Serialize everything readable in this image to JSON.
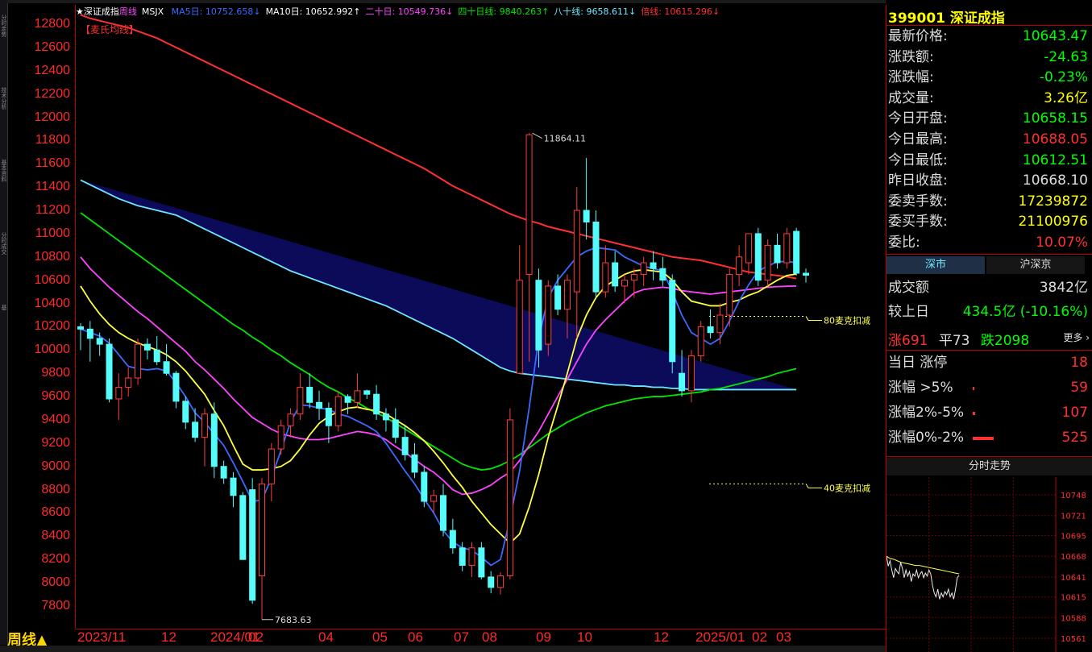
{
  "left_strip": [
    "分时走势",
    "技术分析",
    "基本资料",
    "分时成交",
    "基"
  ],
  "legend": {
    "star": "★",
    "name": "深证成指",
    "period": "周线",
    "code": "MSJX",
    "items": [
      {
        "label": "MA5日: 10752.658↓",
        "color": "#3a6bff"
      },
      {
        "label": "MA10日: 10652.992↑",
        "color": "#ffffff"
      },
      {
        "label": "二十日: 10549.736↓",
        "color": "#ff44ff"
      },
      {
        "label": "四十日线: 9840.263↑",
        "color": "#00e600"
      },
      {
        "label": "八十线: 9658.611↓",
        "color": "#6de7ff"
      },
      {
        "label": "倍线: 10615.296↓",
        "color": "#ff3030"
      }
    ],
    "tag": "【麦氏均线】"
  },
  "y_axis": {
    "ticks": [
      "12800",
      "12600",
      "12400",
      "12200",
      "12000",
      "11800",
      "11600",
      "11400",
      "11200",
      "11000",
      "10800",
      "10600",
      "10400",
      "10200",
      "10000",
      "9800",
      "9600",
      "9400",
      "9200",
      "9000",
      "8800",
      "8600",
      "8400",
      "8200",
      "8000",
      "7800"
    ]
  },
  "x_axis": {
    "labels": [
      "2023/11",
      "12",
      "2024/01",
      "02",
      "04",
      "05",
      "06",
      "07",
      "08",
      "09",
      "10",
      "12",
      "2025/01",
      "02",
      "03"
    ],
    "period_label": "周线▲"
  },
  "annotations": {
    "high": "11864.11",
    "low": "7683.63",
    "line80": "80麦克扣减",
    "line40": "40麦克扣减"
  },
  "colors": {
    "up": "#ff3c3c",
    "down": "#54fcfc",
    "axis": "#ff2a2a"
  },
  "chart_data": {
    "type": "candlestick",
    "title": "深证成指 周线",
    "ylim": [
      7650,
      12950
    ],
    "categories": [
      "2023/11",
      "",
      "",
      "",
      "12",
      "",
      "",
      "",
      "2024/01",
      "",
      "",
      "",
      "02",
      "",
      "",
      "04",
      "",
      "",
      "",
      "05",
      "",
      "",
      "06",
      "",
      "",
      "",
      "07",
      "",
      "",
      "",
      "08",
      "",
      "",
      "",
      "09",
      "",
      "",
      "",
      "10",
      "",
      "",
      "",
      "",
      "12",
      "",
      "",
      "",
      "2025/01",
      "",
      "",
      "02",
      "",
      "",
      "",
      "03",
      "",
      "",
      ""
    ],
    "ohlc": [
      [
        10200,
        10230,
        10000,
        10180
      ],
      [
        10180,
        10250,
        9900,
        10100
      ],
      [
        10100,
        10150,
        9950,
        10050
      ],
      [
        10050,
        10100,
        9550,
        9580
      ],
      [
        9580,
        9800,
        9400,
        9680
      ],
      [
        9680,
        9850,
        9600,
        9760
      ],
      [
        9760,
        10100,
        9700,
        10050
      ],
      [
        10050,
        10100,
        9920,
        10000
      ],
      [
        10000,
        10120,
        9870,
        9900
      ],
      [
        9900,
        10050,
        9780,
        9800
      ],
      [
        9800,
        9820,
        9500,
        9560
      ],
      [
        9560,
        9600,
        9320,
        9380
      ],
      [
        9380,
        9500,
        9210,
        9250
      ],
      [
        9250,
        9500,
        9000,
        9450
      ],
      [
        9450,
        9550,
        8900,
        9000
      ],
      [
        9000,
        9050,
        8850,
        8900
      ],
      [
        8900,
        8950,
        8650,
        8750
      ],
      [
        8750,
        8780,
        8200,
        8200
      ],
      [
        8800,
        8900,
        7820,
        7850
      ],
      [
        8060,
        8900,
        7684,
        8850
      ],
      [
        8850,
        9200,
        8700,
        9150
      ],
      [
        9150,
        9400,
        9100,
        9350
      ],
      [
        9350,
        9500,
        9250,
        9450
      ],
      [
        9450,
        9800,
        9400,
        9680
      ],
      [
        9680,
        9800,
        9500,
        9550
      ],
      [
        9550,
        9650,
        9400,
        9500
      ],
      [
        9500,
        9550,
        9200,
        9350
      ],
      [
        9350,
        9650,
        9300,
        9600
      ],
      [
        9600,
        9620,
        9450,
        9550
      ],
      [
        9550,
        9800,
        9500,
        9650
      ],
      [
        9650,
        9660,
        9580,
        9620
      ],
      [
        9620,
        9700,
        9400,
        9450
      ],
      [
        9450,
        9500,
        9300,
        9400
      ],
      [
        9400,
        9500,
        9200,
        9250
      ],
      [
        9250,
        9350,
        9050,
        9100
      ],
      [
        9100,
        9200,
        8900,
        8950
      ],
      [
        8950,
        9000,
        8650,
        8700
      ],
      [
        8700,
        8800,
        8600,
        8750
      ],
      [
        8750,
        8850,
        8400,
        8450
      ],
      [
        8450,
        8550,
        8250,
        8300
      ],
      [
        8300,
        8350,
        8100,
        8150
      ],
      [
        8150,
        8350,
        8050,
        8300
      ],
      [
        8300,
        8350,
        8030,
        8050
      ],
      [
        8050,
        8100,
        7910,
        7960
      ],
      [
        7960,
        8090,
        7900,
        8060
      ],
      [
        8060,
        9500,
        8030,
        9400
      ],
      [
        9800,
        10900,
        9800,
        10600
      ],
      [
        10650,
        11864,
        9900,
        11850
      ],
      [
        10600,
        10700,
        9850,
        10000
      ],
      [
        10050,
        10600,
        9950,
        10550
      ],
      [
        10550,
        10650,
        10300,
        10350
      ],
      [
        10350,
        10650,
        10100,
        10600
      ],
      [
        10500,
        11400,
        10100,
        11200
      ],
      [
        11200,
        11650,
        10950,
        11100
      ],
      [
        11100,
        11200,
        10450,
        10500
      ],
      [
        10500,
        10900,
        10450,
        10750
      ],
      [
        10750,
        10850,
        10500,
        10550
      ],
      [
        10550,
        10650,
        10400,
        10600
      ],
      [
        10600,
        10700,
        10450,
        10650
      ],
      [
        10650,
        10800,
        10550,
        10750
      ],
      [
        10750,
        10850,
        10600,
        10700
      ],
      [
        10700,
        10800,
        10550,
        10600
      ],
      [
        10600,
        10650,
        9800,
        9900
      ],
      [
        9800,
        10000,
        9600,
        9650
      ],
      [
        9650,
        10000,
        9550,
        9950
      ],
      [
        9950,
        10250,
        9900,
        10200
      ],
      [
        10200,
        10350,
        10100,
        10150
      ],
      [
        10150,
        10400,
        10050,
        10300
      ],
      [
        10300,
        10700,
        10200,
        10650
      ],
      [
        10650,
        10900,
        10550,
        10800
      ],
      [
        10750,
        11000,
        10650,
        11000
      ],
      [
        11000,
        11050,
        10550,
        10600
      ],
      [
        10600,
        10950,
        10550,
        10900
      ],
      [
        10900,
        11000,
        10700,
        10750
      ],
      [
        10750,
        11050,
        10700,
        11000
      ],
      [
        11020,
        11050,
        10640,
        10660
      ],
      [
        10660,
        10700,
        10580,
        10643
      ]
    ],
    "series": [
      {
        "name": "MA5日",
        "color": "#3a6bff",
        "values": [
          10180,
          10150,
          10120,
          10060,
          9960,
          9860,
          9840,
          9830,
          9840,
          9820,
          9720,
          9600,
          9460,
          9380,
          9280,
          9180,
          9030,
          8870,
          8700,
          8710,
          8900,
          9140,
          9380,
          9530,
          9520,
          9500,
          9490,
          9450,
          9430,
          9390,
          9350,
          9300,
          9200,
          9080,
          8960,
          8850,
          8720,
          8600,
          8450,
          8350,
          8300,
          8280,
          8220,
          8150,
          8200,
          8550,
          8960,
          9500,
          10100,
          10450,
          10600,
          10700,
          10800,
          10850,
          10880,
          10870,
          10860,
          10800,
          10760,
          10720,
          10700,
          10680,
          10500,
          10300,
          10150,
          10100,
          10050,
          10100,
          10250,
          10420,
          10560,
          10680,
          10720,
          10760,
          10760,
          10752
        ]
      },
      {
        "name": "MA10日",
        "color": "#ffff40",
        "values": [
          10550,
          10420,
          10310,
          10220,
          10150,
          10100,
          10060,
          10030,
          10000,
          9960,
          9900,
          9820,
          9720,
          9620,
          9480,
          9350,
          9180,
          9020,
          8970,
          8970,
          8980,
          9000,
          9050,
          9150,
          9270,
          9370,
          9430,
          9470,
          9500,
          9510,
          9490,
          9480,
          9450,
          9400,
          9350,
          9290,
          9220,
          9130,
          9030,
          8920,
          8820,
          8700,
          8600,
          8500,
          8420,
          8340,
          8420,
          8650,
          8930,
          9250,
          9520,
          9800,
          10100,
          10300,
          10450,
          10550,
          10600,
          10650,
          10680,
          10690,
          10680,
          10670,
          10600,
          10500,
          10420,
          10400,
          10380,
          10380,
          10410,
          10430,
          10470,
          10500,
          10550,
          10600,
          10640,
          10653
        ]
      },
      {
        "name": "二十日",
        "color": "#ff44ff",
        "values": [
          10800,
          10700,
          10620,
          10540,
          10470,
          10400,
          10330,
          10270,
          10200,
          10130,
          10060,
          9990,
          9900,
          9830,
          9750,
          9670,
          9580,
          9500,
          9420,
          9370,
          9320,
          9280,
          9260,
          9240,
          9230,
          9230,
          9240,
          9260,
          9280,
          9300,
          9290,
          9270,
          9230,
          9170,
          9120,
          9060,
          9000,
          8950,
          8880,
          8800,
          8760,
          8770,
          8800,
          8840,
          8900,
          8950,
          9050,
          9180,
          9300,
          9450,
          9600,
          9750,
          9900,
          10050,
          10170,
          10260,
          10340,
          10420,
          10490,
          10520,
          10530,
          10540,
          10530,
          10510,
          10500,
          10490,
          10480,
          10490,
          10500,
          10510,
          10520,
          10530,
          10540,
          10545,
          10548,
          10550
        ]
      },
      {
        "name": "四十日线",
        "color": "#00e600",
        "values": [
          11180,
          11120,
          11060,
          11000,
          10940,
          10880,
          10820,
          10760,
          10700,
          10640,
          10580,
          10520,
          10460,
          10400,
          10340,
          10280,
          10220,
          10170,
          10110,
          10060,
          10000,
          9950,
          9890,
          9840,
          9790,
          9730,
          9680,
          9640,
          9590,
          9550,
          9500,
          9460,
          9420,
          9370,
          9320,
          9270,
          9220,
          9170,
          9120,
          9070,
          9020,
          8990,
          8970,
          8980,
          9010,
          9050,
          9100,
          9160,
          9220,
          9280,
          9330,
          9380,
          9420,
          9460,
          9490,
          9520,
          9540,
          9560,
          9580,
          9590,
          9600,
          9600,
          9610,
          9620,
          9630,
          9640,
          9660,
          9670,
          9690,
          9710,
          9730,
          9750,
          9770,
          9800,
          9820,
          9840
        ]
      },
      {
        "name": "八十线",
        "color": "#6de7ff",
        "values": [
          11460,
          11420,
          11380,
          11340,
          11300,
          11270,
          11240,
          11220,
          11200,
          11180,
          11160,
          11120,
          11080,
          11040,
          11000,
          10960,
          10920,
          10880,
          10840,
          10800,
          10760,
          10720,
          10680,
          10650,
          10620,
          10590,
          10560,
          10530,
          10500,
          10470,
          10440,
          10410,
          10380,
          10340,
          10300,
          10260,
          10220,
          10180,
          10140,
          10100,
          10050,
          10000,
          9950,
          9900,
          9850,
          9820,
          9800,
          9790,
          9780,
          9770,
          9760,
          9750,
          9740,
          9730,
          9720,
          9710,
          9700,
          9700,
          9690,
          9690,
          9680,
          9680,
          9670,
          9670,
          9660,
          9660,
          9660,
          9660,
          9660,
          9660,
          9660,
          9660,
          9660,
          9660,
          9660,
          9660
        ]
      },
      {
        "name": "倍线",
        "color": "#ff3030",
        "values": [
          12880,
          12850,
          12830,
          12810,
          12790,
          12770,
          12740,
          12710,
          12680,
          12640,
          12600,
          12560,
          12520,
          12480,
          12440,
          12400,
          12360,
          12320,
          12280,
          12240,
          12200,
          12160,
          12120,
          12080,
          12040,
          12000,
          11960,
          11920,
          11880,
          11840,
          11800,
          11760,
          11720,
          11680,
          11640,
          11600,
          11560,
          11510,
          11460,
          11410,
          11370,
          11330,
          11290,
          11250,
          11210,
          11170,
          11140,
          11110,
          11090,
          11060,
          11040,
          11020,
          11000,
          10980,
          10960,
          10940,
          10920,
          10900,
          10880,
          10860,
          10840,
          10820,
          10800,
          10790,
          10780,
          10770,
          10750,
          10730,
          10710,
          10690,
          10670,
          10660,
          10650,
          10640,
          10630,
          10615
        ]
      }
    ],
    "horizontal_levels": [
      {
        "label": "80麦克扣减",
        "value": 10290
      },
      {
        "label": "40麦克扣减",
        "value": 8850
      }
    ]
  },
  "panel": {
    "code": "399001",
    "name": "深证成指",
    "rows": [
      {
        "k": "最新价格:",
        "v": "10643.47",
        "c": "#00ff00"
      },
      {
        "k": "涨跌额:",
        "v": "-24.63",
        "c": "#00ff00"
      },
      {
        "k": "涨跌幅:",
        "v": "-0.23%",
        "c": "#00ff00"
      },
      {
        "k": "成交量:",
        "v": "3.26亿",
        "c": "#ffff00"
      },
      {
        "k": "今日开盘:",
        "v": "10658.15",
        "c": "#00ff00"
      },
      {
        "k": "今日最高:",
        "v": "10688.05",
        "c": "#ff3030"
      },
      {
        "k": "今日最低:",
        "v": "10612.51",
        "c": "#00ff00"
      },
      {
        "k": "昨日收盘:",
        "v": "10668.10",
        "c": "#dddddd"
      },
      {
        "k": "委卖手数:",
        "v": "17239872",
        "c": "#ffff00"
      },
      {
        "k": "委买手数:",
        "v": "21100976",
        "c": "#ffff00"
      },
      {
        "k": "委比:",
        "v": "10.07%",
        "c": "#ff3030"
      }
    ],
    "tabs": [
      "深市",
      "沪深京"
    ],
    "stats": [
      {
        "k": "成交额",
        "v": "3842亿",
        "c": "#dddddd"
      },
      {
        "k": "较上日",
        "v": "434.5亿 (-10.16%)",
        "c": "#00ff00"
      }
    ],
    "breadth": {
      "up": "涨691",
      "flat": "平73",
      "down": "跌2098",
      "more": "更多 ›"
    },
    "limit": [
      {
        "k": "当日 涨停",
        "v": "18",
        "bar": 0
      },
      {
        "k": "涨幅 >5%",
        "v": "59",
        "bar": 2
      },
      {
        "k": "涨幅2%-5%",
        "v": "107",
        "bar": 3
      },
      {
        "k": "涨幅0%-2%",
        "v": "525",
        "bar": 26
      }
    ],
    "intraday": {
      "title": "分时走势",
      "ticks": [
        "10748",
        "10721",
        "10695",
        "10668",
        "10641",
        "10615",
        "10588",
        "10561"
      ],
      "price": [
        10668,
        10655,
        10662,
        10650,
        10640,
        10652,
        10648,
        10645,
        10660,
        10652,
        10640,
        10650,
        10642,
        10648,
        10635,
        10645,
        10642,
        10650,
        10640,
        10645,
        10648,
        10640,
        10646,
        10642,
        10650,
        10645,
        10630,
        10620,
        10615,
        10625,
        10612,
        10620,
        10615,
        10622,
        10618,
        10625,
        10615,
        10620,
        10612,
        10625,
        10640,
        10643
      ],
      "avg": [
        10668,
        10665,
        10664,
        10662,
        10660,
        10659,
        10658,
        10657,
        10656,
        10656,
        10655,
        10654,
        10653,
        10652,
        10651,
        10650,
        10649,
        10648,
        10647,
        10646,
        10645
      ]
    }
  }
}
